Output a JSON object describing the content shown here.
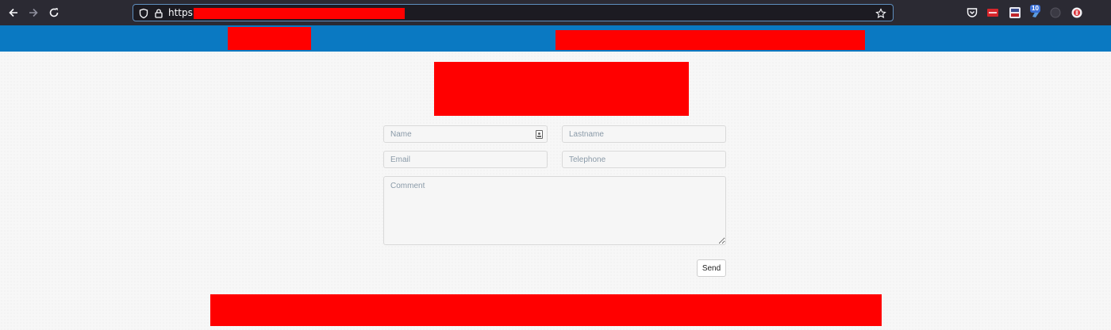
{
  "browser": {
    "url_text": "https://chat",
    "extension_badge": "10",
    "icons": [
      "back-arrow-icon",
      "forward-arrow-icon",
      "reload-icon",
      "shield-icon",
      "lock-icon",
      "bookmark-star-icon",
      "pocket-icon",
      "extension-icon",
      "puzzle-icon",
      "profile-icon"
    ]
  },
  "colors": {
    "toolbar": "#2b2a33",
    "header": "#0a79c2",
    "redaction": "#ff0000",
    "page_background": "#f7f7f7"
  },
  "form": {
    "name_placeholder": "Name",
    "lastname_placeholder": "Lastname",
    "email_placeholder": "Email",
    "telephone_placeholder": "Telephone",
    "comment_placeholder": "Comment",
    "send_label": "Send"
  }
}
